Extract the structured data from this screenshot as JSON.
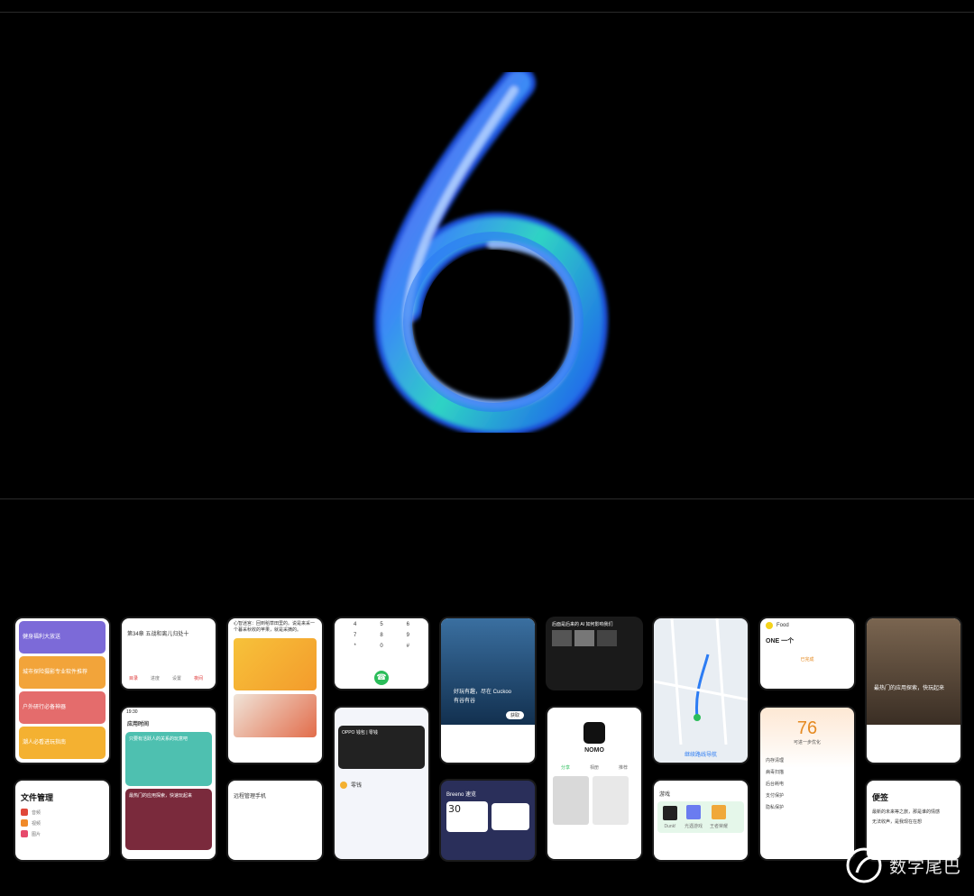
{
  "phones": {
    "fitness": {
      "items": [
        "健身福利大放送",
        "城市探险摄影专业软件推荐",
        "户外研行必备神器",
        "潮人必看进玩指南"
      ]
    },
    "reader": {
      "chapter": "第34章 五战和离儿归处十",
      "tools": [
        "目录",
        "进度",
        "设置",
        "夜间"
      ]
    },
    "story": {
      "text": "心智迷宫：回到稻草田里的。说是来采一个暮采秋收的苹果，就是采摘的。"
    },
    "dialer": {
      "keys": [
        "4",
        "5",
        "6",
        "7",
        "8",
        "9",
        "*",
        "0",
        "#"
      ]
    },
    "whale": {
      "headline": "好玩有趣，尽在 Cuckoo",
      "sub": "有谷有谷",
      "badge": "获取"
    },
    "video": {
      "title": "后面是后来的 AI 如何影响我们"
    },
    "map": {
      "action": "继续路线导航"
    },
    "widgets": {
      "top": "Food",
      "one": "ONE 一个",
      "green": "已完成"
    },
    "room": {
      "headline": "最热门的应用探索，快玩起来"
    },
    "usage": {
      "title": "应用时间",
      "headline": "只要有活跃人的关系的玩意吧",
      "mario": "最热门的应用探索，快速玩起来"
    },
    "tools": {
      "title": "远程管理手机"
    },
    "card": {
      "name": "OPPO 钱包 | 零钱",
      "sub": "零钱"
    },
    "nomo": {
      "brand": "NOMO",
      "tabs": [
        "分享",
        "相册",
        "推荐"
      ]
    },
    "battery": {
      "score": "76",
      "sub": "可进一步优化",
      "rows": [
        "内存清理",
        "病毒扫描",
        "后台耗电",
        "支付保护",
        "隐私保护"
      ]
    },
    "files": {
      "title": "文件管理",
      "rows": [
        "音频",
        "视频",
        "图片",
        "文档"
      ]
    },
    "breeno": {
      "title": "Breeno 速览",
      "num": "30"
    },
    "games": {
      "title": "游戏",
      "apps": [
        "Dunk!",
        "光遇游戏",
        "王者荣耀"
      ]
    },
    "notes": {
      "title": "便签",
      "l1": "最新的未来等之旅，那是谁的情感",
      "l2": "无法收声，是我现在在想"
    }
  },
  "watermark": {
    "text": "数字尾巴"
  },
  "colors": {
    "bg": "#000000",
    "blue": "#1e6cf0"
  }
}
